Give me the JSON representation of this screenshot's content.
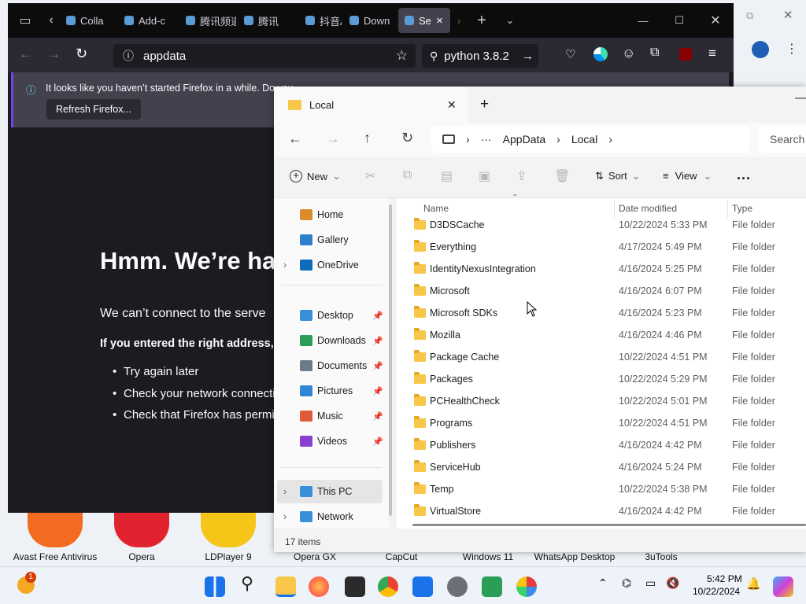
{
  "desktop": {
    "icons": [
      {
        "label": "Avast Free Antivirus",
        "color": "#f26b21"
      },
      {
        "label": "Opera",
        "color": "#e0232f"
      },
      {
        "label": "LDPlayer 9",
        "color": "#f5c518"
      },
      {
        "label": "Opera GX",
        "color": "#222"
      },
      {
        "label": "CapCut",
        "color": "#111"
      },
      {
        "label": "Windows 11",
        "color": "#1f7ae0"
      },
      {
        "label": "WhatsApp Desktop",
        "color": "#25d366"
      },
      {
        "label": "3uTools",
        "color": "#1976d2"
      }
    ]
  },
  "firefox": {
    "tabs": [
      "Colla",
      "Add-c",
      "腾讯频道",
      "腾讯",
      "抖音A",
      "Down",
      "Se"
    ],
    "url": "appdata",
    "search": "python 3.8.2",
    "notice": {
      "text": "It looks like you haven’t started Firefox in a while. Do you",
      "button": "Refresh Firefox..."
    },
    "error": {
      "title": "Hmm. We’re ha",
      "line1": "We can’t connect to the serve",
      "line2": "If you entered the right address,",
      "bullets": [
        "Try again later",
        "Check your network connecti",
        "Check that Firefox has permis"
      ]
    }
  },
  "explorer": {
    "tab_title": "Local",
    "breadcrumb": [
      "AppData",
      "Local"
    ],
    "search_placeholder": "Search",
    "toolbar": {
      "new": "New",
      "sort": "Sort",
      "view": "View",
      "more": "..."
    },
    "columns": {
      "name": "Name",
      "date": "Date modified",
      "type": "Type"
    },
    "sidebar": [
      {
        "label": "Home",
        "color": "#d98e2b"
      },
      {
        "label": "Gallery",
        "color": "#2f7fcf"
      },
      {
        "label": "OneDrive",
        "color": "#0f6cbd"
      },
      {
        "label": "Desktop",
        "color": "#3a8fd9",
        "pinned": true
      },
      {
        "label": "Downloads",
        "color": "#2a9d56",
        "pinned": true
      },
      {
        "label": "Documents",
        "color": "#6d7a8a",
        "pinned": true
      },
      {
        "label": "Pictures",
        "color": "#2f86d6",
        "pinned": true
      },
      {
        "label": "Music",
        "color": "#e05b3a",
        "pinned": true
      },
      {
        "label": "Videos",
        "color": "#8a3fd1",
        "pinned": true
      },
      {
        "label": "This PC",
        "color": "#3a8fd9"
      },
      {
        "label": "Network",
        "color": "#3a8fd9"
      }
    ],
    "files": [
      {
        "name": "D3DSCache",
        "date": "10/22/2024 5:33 PM",
        "type": "File folder"
      },
      {
        "name": "Everything",
        "date": "4/17/2024 5:49 PM",
        "type": "File folder"
      },
      {
        "name": "IdentityNexusIntegration",
        "date": "4/16/2024 5:25 PM",
        "type": "File folder"
      },
      {
        "name": "Microsoft",
        "date": "4/16/2024 6:07 PM",
        "type": "File folder"
      },
      {
        "name": "Microsoft SDKs",
        "date": "4/16/2024 5:23 PM",
        "type": "File folder"
      },
      {
        "name": "Mozilla",
        "date": "4/16/2024 4:46 PM",
        "type": "File folder"
      },
      {
        "name": "Package Cache",
        "date": "10/22/2024 4:51 PM",
        "type": "File folder"
      },
      {
        "name": "Packages",
        "date": "10/22/2024 5:29 PM",
        "type": "File folder"
      },
      {
        "name": "PCHealthCheck",
        "date": "10/22/2024 5:01 PM",
        "type": "File folder"
      },
      {
        "name": "Programs",
        "date": "10/22/2024 4:51 PM",
        "type": "File folder"
      },
      {
        "name": "Publishers",
        "date": "4/16/2024 4:42 PM",
        "type": "File folder"
      },
      {
        "name": "ServiceHub",
        "date": "4/16/2024 5:24 PM",
        "type": "File folder"
      },
      {
        "name": "Temp",
        "date": "10/22/2024 5:38 PM",
        "type": "File folder"
      },
      {
        "name": "VirtualStore",
        "date": "4/16/2024 4:42 PM",
        "type": "File folder"
      }
    ],
    "status": "17 items"
  },
  "taskbar": {
    "time": "5:42 PM",
    "date": "10/22/2024",
    "badge": "1"
  }
}
